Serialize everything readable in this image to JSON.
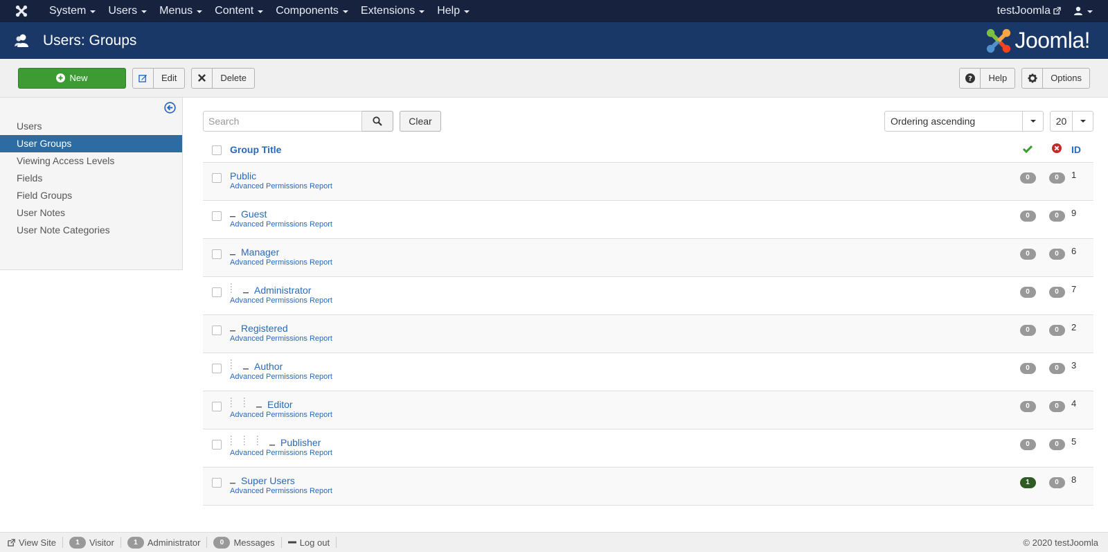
{
  "navbar": {
    "menu": [
      {
        "label": "System"
      },
      {
        "label": "Users"
      },
      {
        "label": "Menus"
      },
      {
        "label": "Content"
      },
      {
        "label": "Components"
      },
      {
        "label": "Extensions"
      },
      {
        "label": "Help"
      }
    ],
    "site_name": "testJoomla",
    "site_icon": "external-link-icon",
    "user_icon": "user-icon"
  },
  "header": {
    "title": "Users: Groups",
    "icon": "users-icon",
    "brand": "Joomla!"
  },
  "toolbar": {
    "new_label": "New",
    "edit_label": "Edit",
    "delete_label": "Delete",
    "help_label": "Help",
    "options_label": "Options"
  },
  "sidebar": {
    "items": [
      {
        "label": "Users",
        "active": false
      },
      {
        "label": "User Groups",
        "active": true
      },
      {
        "label": "Viewing Access Levels",
        "active": false
      },
      {
        "label": "Fields",
        "active": false
      },
      {
        "label": "Field Groups",
        "active": false
      },
      {
        "label": "User Notes",
        "active": false
      },
      {
        "label": "User Note Categories",
        "active": false
      }
    ]
  },
  "filters": {
    "search_placeholder": "Search",
    "clear_label": "Clear",
    "ordering": "Ordering ascending",
    "limit": "20"
  },
  "table": {
    "headers": {
      "title": "Group Title",
      "enabled_icon": "check-icon",
      "blocked_icon": "times-circle-icon",
      "id": "ID"
    },
    "rows": [
      {
        "title": "Public",
        "level": 0,
        "link": "Advanced Permissions Report",
        "enabled": "0",
        "blocked": "0",
        "id": "1"
      },
      {
        "title": "Guest",
        "level": 1,
        "link": "Advanced Permissions Report",
        "enabled": "0",
        "blocked": "0",
        "id": "9"
      },
      {
        "title": "Manager",
        "level": 1,
        "link": "Advanced Permissions Report",
        "enabled": "0",
        "blocked": "0",
        "id": "6"
      },
      {
        "title": "Administrator",
        "level": 2,
        "link": "Advanced Permissions Report",
        "enabled": "0",
        "blocked": "0",
        "id": "7"
      },
      {
        "title": "Registered",
        "level": 1,
        "link": "Advanced Permissions Report",
        "enabled": "0",
        "blocked": "0",
        "id": "2"
      },
      {
        "title": "Author",
        "level": 2,
        "link": "Advanced Permissions Report",
        "enabled": "0",
        "blocked": "0",
        "id": "3"
      },
      {
        "title": "Editor",
        "level": 3,
        "link": "Advanced Permissions Report",
        "enabled": "0",
        "blocked": "0",
        "id": "4"
      },
      {
        "title": "Publisher",
        "level": 4,
        "link": "Advanced Permissions Report",
        "enabled": "0",
        "blocked": "0",
        "id": "5"
      },
      {
        "title": "Super Users",
        "level": 1,
        "link": "Advanced Permissions Report",
        "enabled": "1",
        "blocked": "0",
        "id": "8"
      }
    ]
  },
  "footer": {
    "view_site": "View Site",
    "visitor_count": "1",
    "visitor_label": "Visitor",
    "admin_count": "1",
    "admin_label": "Administrator",
    "messages_count": "0",
    "messages_label": "Messages",
    "logout_label": "Log out",
    "copyright": "© 2020 testJoomla"
  },
  "colors": {
    "navbar": "#17233e",
    "header": "#1a3867",
    "new_button": "#3d9b33",
    "active_sidebar": "#2d6ca2",
    "link": "#2a69b8",
    "badge_enabled": "#2f5c25"
  }
}
